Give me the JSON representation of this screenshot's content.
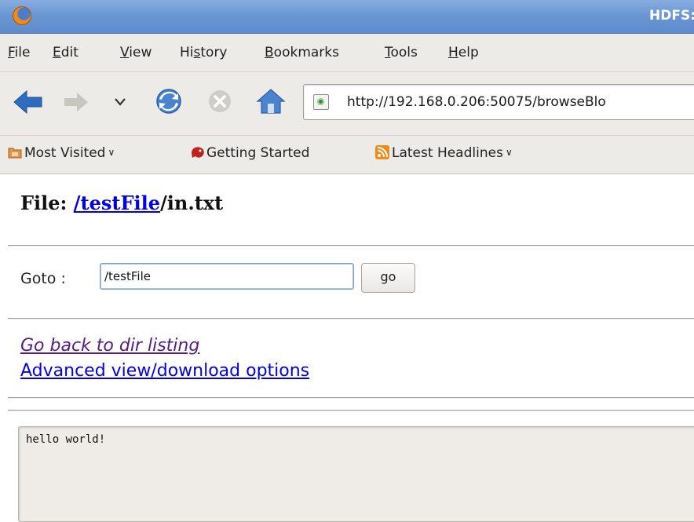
{
  "window": {
    "title": "HDFS:"
  },
  "menu": [
    {
      "pre": "",
      "acc": "F",
      "post": "ile"
    },
    {
      "pre": "",
      "acc": "E",
      "post": "dit"
    },
    {
      "pre": "",
      "acc": "V",
      "post": "iew"
    },
    {
      "pre": "Hi",
      "acc": "s",
      "post": "tory"
    },
    {
      "pre": "",
      "acc": "B",
      "post": "ookmarks"
    },
    {
      "pre": "",
      "acc": "T",
      "post": "ools"
    },
    {
      "pre": "",
      "acc": "H",
      "post": "elp"
    }
  ],
  "navbar": {
    "url": "http://192.168.0.206:50075/browseBlo",
    "icons": [
      "back-arrow-icon",
      "forward-arrow-icon",
      "history-dropdown-icon",
      "reload-icon",
      "stop-icon",
      "home-icon"
    ]
  },
  "bookmarks": [
    {
      "label": "Most Visited",
      "dropdown": true
    },
    {
      "label": "Getting Started",
      "dropdown": false
    },
    {
      "label": "Latest Headlines",
      "dropdown": true
    }
  ],
  "page": {
    "heading_prefix": "File: ",
    "heading_dir_link": "/testFile",
    "heading_file": "/in.txt",
    "goto_label": "Goto :",
    "goto_value": "/testFile",
    "go_button": "go",
    "back_link": "Go back to dir listing",
    "advanced_link": "Advanced view/download options",
    "file_contents": "hello world!"
  },
  "colors": {
    "titlebar": "#6b97d3",
    "chrome": "#edebe7",
    "link": "#0000ee",
    "visited_link": "#551a8b"
  }
}
